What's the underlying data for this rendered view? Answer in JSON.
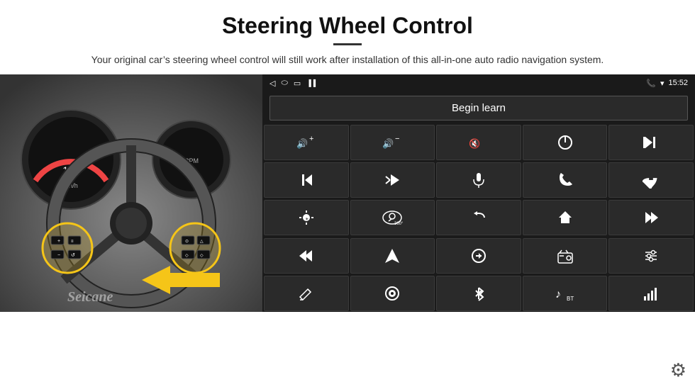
{
  "header": {
    "title": "Steering Wheel Control",
    "subtitle": "Your original car’s steering wheel control will still work after installation of this all-in-one auto radio navigation system."
  },
  "panel": {
    "status_bar": {
      "back_icon": "◁",
      "home_icon": "□",
      "recent_icon": "□",
      "signal_icon": "▐▐",
      "phone_icon": "☎",
      "wifi_icon": "▾",
      "time": "15:52"
    },
    "begin_learn_label": "Begin learn",
    "controls": [
      {
        "icon": "🔊+",
        "label": "vol-up"
      },
      {
        "icon": "🔊−",
        "label": "vol-down"
      },
      {
        "icon": "🔇",
        "label": "mute"
      },
      {
        "icon": "⏻",
        "label": "power"
      },
      {
        "icon": "⏮",
        "label": "prev-track"
      },
      {
        "icon": "⏭",
        "label": "next"
      },
      {
        "icon": "⏩",
        "label": "fast-forward"
      },
      {
        "icon": "🎤",
        "label": "mic"
      },
      {
        "icon": "📞",
        "label": "call"
      },
      {
        "icon": "↩",
        "label": "hang-up"
      },
      {
        "icon": "🔦",
        "label": "brightness"
      },
      {
        "icon": "👁",
        "label": "360-view"
      },
      {
        "icon": "↺",
        "label": "back"
      },
      {
        "icon": "🏠",
        "label": "home"
      },
      {
        "icon": "⏮",
        "label": "rewind"
      },
      {
        "icon": "⏭",
        "label": "skip"
      },
      {
        "icon": "▲",
        "label": "navigate"
      },
      {
        "icon": "⇄",
        "label": "swap"
      },
      {
        "icon": "📻",
        "label": "radio"
      },
      {
        "icon": "⚙",
        "label": "eq"
      },
      {
        "icon": "✏",
        "label": "edit"
      },
      {
        "icon": "⏺",
        "label": "record"
      },
      {
        "icon": "🔷",
        "label": "bluetooth"
      },
      {
        "icon": "🎵",
        "label": "music"
      },
      {
        "icon": "📶",
        "label": "signal"
      }
    ],
    "watermark": "Seicane"
  },
  "icons": {
    "gear": "⚙",
    "arrow": "➤"
  }
}
